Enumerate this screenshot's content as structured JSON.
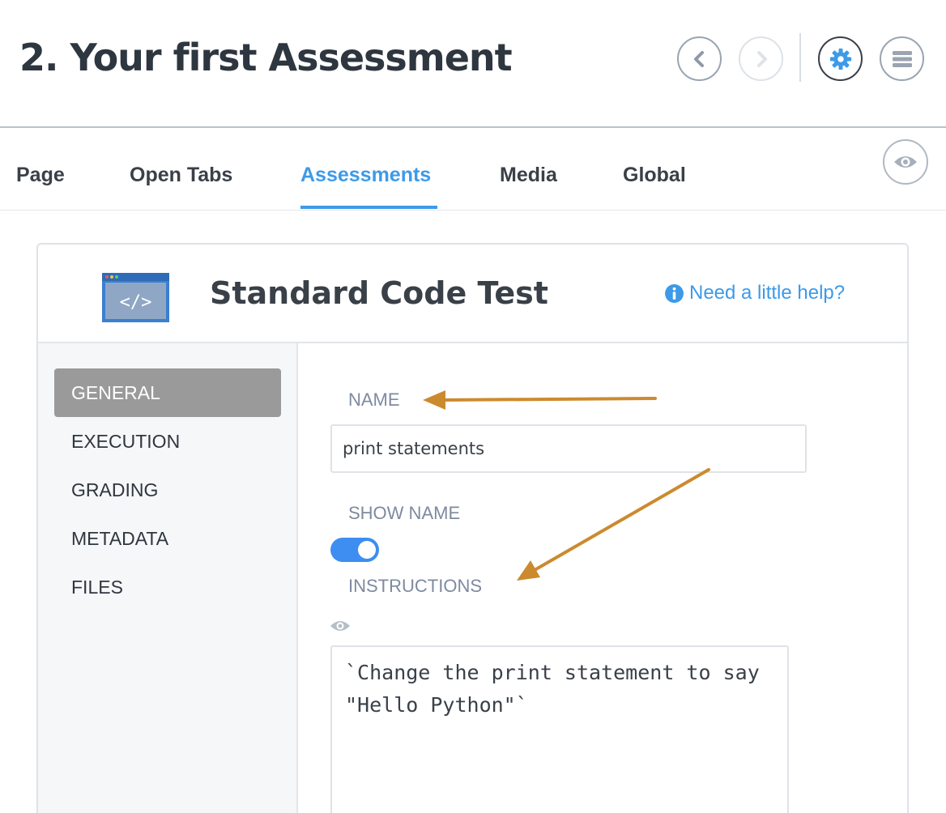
{
  "header": {
    "title": "2. Your first Assessment",
    "buttons": {
      "prev_icon": "chevron-left-icon",
      "next_icon": "chevron-right-icon",
      "settings_icon": "gear-icon",
      "menu_icon": "hamburger-menu-icon"
    }
  },
  "tabs": [
    {
      "label": "Page"
    },
    {
      "label": "Open Tabs"
    },
    {
      "label": "Assessments",
      "active": true
    },
    {
      "label": "Media"
    },
    {
      "label": "Global"
    }
  ],
  "preview_icon": "eye-icon",
  "card": {
    "title": "Standard Code Test",
    "icon": "code-window-icon",
    "help": "Need a little help?",
    "sidebar": [
      {
        "label": "GENERAL",
        "active": true
      },
      {
        "label": "EXECUTION"
      },
      {
        "label": "GRADING"
      },
      {
        "label": "METADATA"
      },
      {
        "label": "FILES"
      }
    ],
    "form": {
      "name_label": "NAME",
      "name_value": "print statements",
      "show_name_label": "SHOW NAME",
      "show_name_enabled": true,
      "instructions_label": "INSTRUCTIONS",
      "instructions_value": "`Change the print statement to say \"Hello Python\"`"
    }
  },
  "colors": {
    "accent": "#3d9ae8",
    "active_sidebar": "#9a9a9a",
    "annotation_arrow": "#cc8a2e",
    "label": "#7e8aa0"
  }
}
